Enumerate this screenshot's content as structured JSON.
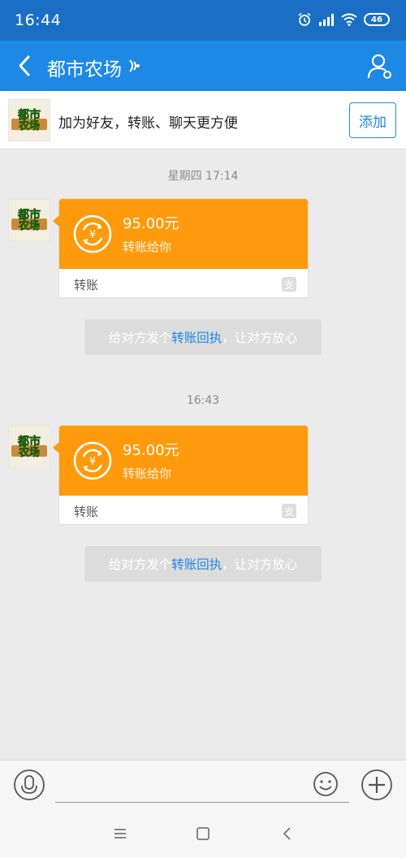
{
  "status_bar": {
    "time": "16:44",
    "battery": "46"
  },
  "header": {
    "title": "都市农场",
    "back_icon": "chevron-left-icon",
    "profile_icon": "user-settings-icon"
  },
  "friend_banner": {
    "avatar_text": "都市农场",
    "text": "加为好友，转账、聊天更方便",
    "add_button": "添加"
  },
  "messages": [
    {
      "timestamp": "星期四 17:14",
      "avatar_text": "都市农场",
      "amount": "95.00元",
      "description": "转账给你",
      "label": "转账",
      "notice_prefix": "给对方发个",
      "notice_link": "转账回执",
      "notice_suffix": "，让对方放心"
    },
    {
      "timestamp": "16:43",
      "avatar_text": "都市农场",
      "amount": "95.00元",
      "description": "转账给你",
      "label": "转账",
      "notice_prefix": "给对方发个",
      "notice_link": "转账回执",
      "notice_suffix": "，让对方放心"
    }
  ],
  "input_bar": {
    "placeholder": ""
  },
  "colors": {
    "status_bar": "#1a6fc4",
    "header": "#1e88e5",
    "transfer_orange": "#fe9a0b",
    "link_blue": "#1e88e5"
  }
}
